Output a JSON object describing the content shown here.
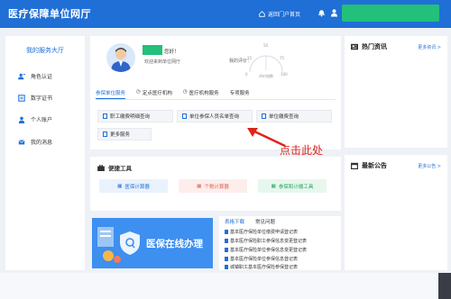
{
  "header": {
    "title": "医疗保障单位网厅",
    "portal_label": "返回门户首页"
  },
  "sidebar": {
    "title": "我的服务大厅",
    "items": [
      {
        "label": "角色认证",
        "icon": "role-icon"
      },
      {
        "label": "数字证书",
        "icon": "certificate-icon"
      },
      {
        "label": "个人账户",
        "icon": "person-icon"
      },
      {
        "label": "我的消息",
        "icon": "mail-icon"
      }
    ]
  },
  "profile": {
    "greeting": "您好！",
    "welcome": "欢迎来到单位网厅",
    "rank_label": "我的评价：",
    "gauge_ticks": [
      "0",
      "25",
      "50",
      "75",
      "100"
    ],
    "gauge_caption": "评价指数"
  },
  "tabs": [
    {
      "label": "参保单位服务",
      "active": true
    },
    {
      "label": "定点医疗机构",
      "active": false
    },
    {
      "label": "医疗机构服务",
      "active": false
    },
    {
      "label": "专项服务",
      "active": false
    }
  ],
  "quick_buttons": [
    {
      "label": "职工缴费明细查询"
    },
    {
      "label": "单位参保人员名单查询"
    },
    {
      "label": "单位缴费查询"
    },
    {
      "label": "更多服务"
    }
  ],
  "tools": {
    "title": "便捷工具",
    "items": [
      {
        "label": "医保计算器",
        "color": "#1f6fd6",
        "bg": "#e9f2fd"
      },
      {
        "label": "个税计算器",
        "color": "#e05c4b",
        "bg": "#fdeeec"
      },
      {
        "label": "参保和计缴工具",
        "color": "#23a55a",
        "bg": "#e8f7ee"
      }
    ]
  },
  "banner": {
    "title": "医保在线办理"
  },
  "downloads": {
    "tabs": [
      "表格下载",
      "常见问题"
    ],
    "items": [
      "基本医疗保险单位缴费申请登记表",
      "基本医疗保险职工参保信息变更登记表",
      "基本医疗保险单位参保信息变更登记表",
      "基本医疗保险单位参保信息登记表",
      "城镇职工基本医疗保险参保登记表"
    ]
  },
  "right": {
    "news_title": "热门资讯",
    "news_more": "更多资讯 >",
    "notice_title": "最新公告",
    "notice_more": "更多公告 >"
  },
  "annotation": "点击此处",
  "colors": {
    "primary": "#1f6fd6",
    "accent_green": "#22c07a",
    "annotation_red": "#e0241b"
  }
}
